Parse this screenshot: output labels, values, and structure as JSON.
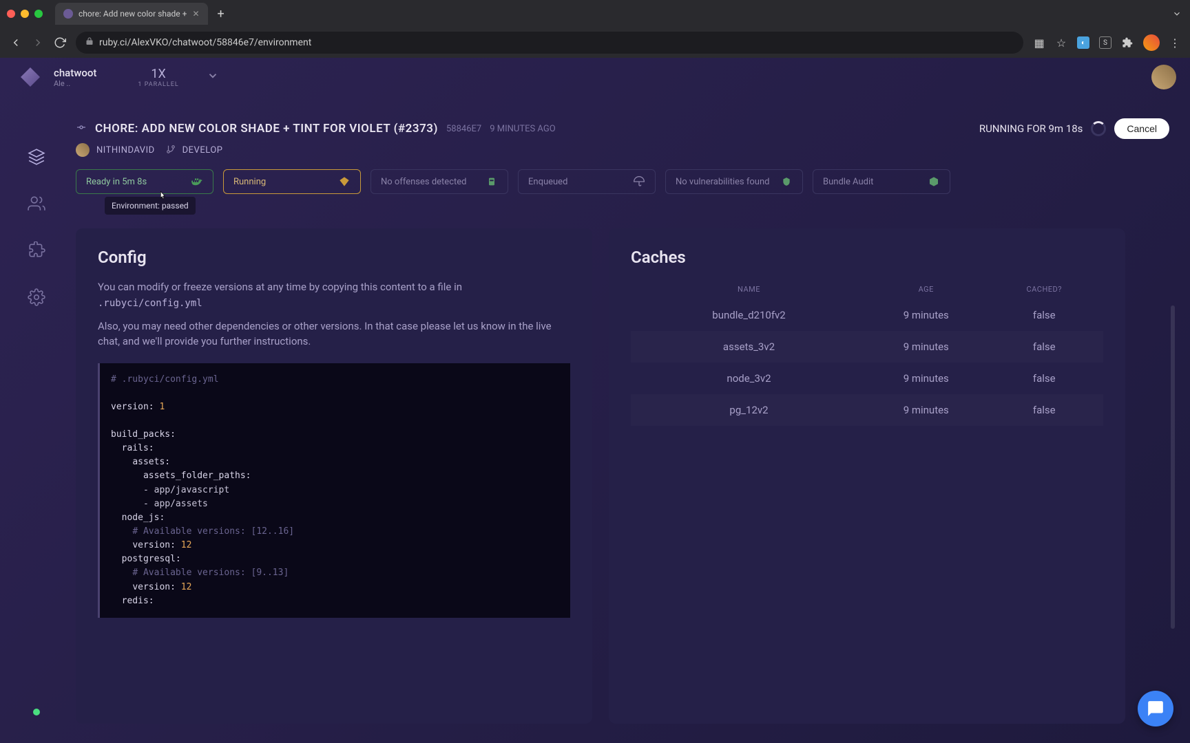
{
  "browser": {
    "tab_title": "chore: Add new color shade +",
    "url": "ruby.ci/AlexVKO/chatwoot/58846e7/environment"
  },
  "project": {
    "name": "chatwoot",
    "sub": "Ale ..",
    "parallel_x": "1X",
    "parallel_label": "1 PARALLEL"
  },
  "build": {
    "title": "CHORE: ADD NEW COLOR SHADE + TINT FOR VIOLET (#2373)",
    "hash": "58846E7",
    "ago": "9 MINUTES AGO",
    "running_for": "RUNNING FOR 9m 18s",
    "cancel": "Cancel",
    "author": "NITHINDAVID",
    "branch": "DEVELOP"
  },
  "tabs": [
    {
      "label": "Ready in 5m 8s",
      "status": "passed"
    },
    {
      "label": "Running",
      "status": "running"
    },
    {
      "label": "No offenses detected",
      "status": "neutral"
    },
    {
      "label": "Enqueued",
      "status": "neutral"
    },
    {
      "label": "No vulnerabilities found",
      "status": "neutral"
    },
    {
      "label": "Bundle Audit",
      "status": "neutral"
    }
  ],
  "tooltip": "Environment: passed",
  "config_panel": {
    "title": "Config",
    "desc1": "You can modify or freeze versions at any time by copying this content to a file in",
    "config_path": ".rubyci/config.yml",
    "desc2": "Also, you may need other dependencies or other versions. In that case please let us know in the live chat, and we'll provide you further instructions.",
    "code": "# .rubyci/config.yml\n\nversion: 1\n\nbuild_packs:\n  rails:\n    assets:\n      assets_folder_paths:\n      - app/javascript\n      - app/assets\n  node_js:\n    # Available versions: [12..16]\n    version: 12\n  postgresql:\n    # Available versions: [9..13]\n    version: 12\n  redis:"
  },
  "caches_panel": {
    "title": "Caches",
    "headers": {
      "name": "NAME",
      "age": "AGE",
      "cached": "CACHED?"
    },
    "rows": [
      {
        "name": "bundle_d210fv2",
        "age": "9 minutes",
        "cached": "false"
      },
      {
        "name": "assets_3v2",
        "age": "9 minutes",
        "cached": "false"
      },
      {
        "name": "node_3v2",
        "age": "9 minutes",
        "cached": "false"
      },
      {
        "name": "pg_12v2",
        "age": "9 minutes",
        "cached": "false"
      }
    ]
  }
}
